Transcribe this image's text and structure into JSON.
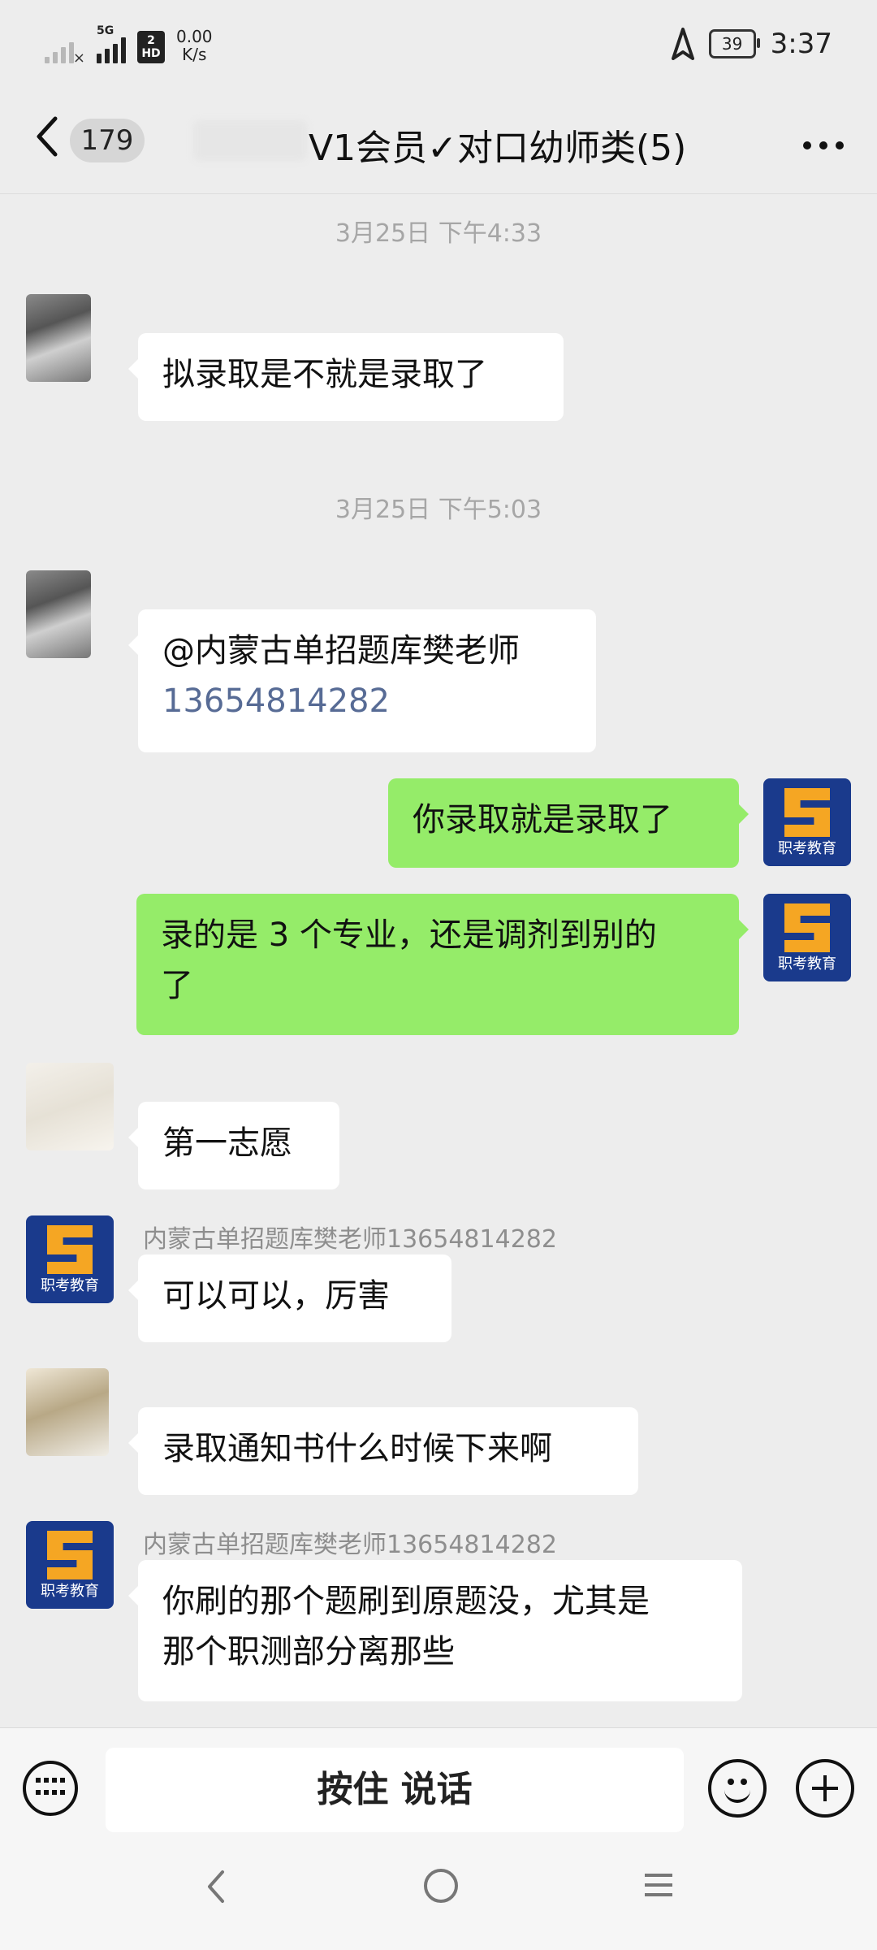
{
  "status_bar": {
    "network_label": "5G",
    "hd_label_top": "2",
    "hd_label_bottom": "HD",
    "speed_value": "0.00",
    "speed_unit": "K/s",
    "battery": "39",
    "time": "3:37"
  },
  "header": {
    "back_icon": "chevron-left-icon",
    "unread_count": "179",
    "title": "V1会员✓对口幼师类(5)",
    "more_icon": "more-icon"
  },
  "messages": [
    {
      "type": "time",
      "text": "3月25日 下午4:33"
    },
    {
      "type": "in",
      "sender": "",
      "text": "拟录取是不就是录取了"
    },
    {
      "type": "time",
      "text": "3月25日 下午5:03"
    },
    {
      "type": "in",
      "sender": "",
      "text": "@内蒙古单招题库樊老师",
      "text2": "13654814282"
    },
    {
      "type": "out",
      "text": "你录取就是录取了"
    },
    {
      "type": "out",
      "text": "录的是 3 个专业，还是调剂到别的",
      "text2": "了"
    },
    {
      "type": "in",
      "sender": "",
      "text": "第一志愿"
    },
    {
      "type": "in",
      "sender": "内蒙古单招题库樊老师13654814282",
      "text": "可以可以，厉害"
    },
    {
      "type": "in",
      "sender": "",
      "text": "录取通知书什么时候下来啊"
    },
    {
      "type": "in",
      "sender": "内蒙古单招题库樊老师13654814282",
      "text": "你刷的那个题刷到原题没，尤其是",
      "text2": "那个职测部分离那些"
    }
  ],
  "logo_label": "职考教育",
  "input_bar": {
    "hold_to_talk": "按住 说话",
    "keyboard_icon": "keyboard-icon",
    "emoji_icon": "emoji-icon",
    "plus_icon": "plus-icon"
  },
  "nav_bar": {
    "back_icon": "nav-back-icon",
    "home_icon": "nav-home-icon",
    "menu_icon": "nav-menu-icon"
  },
  "colors": {
    "background": "#ededed",
    "outgoing_bubble": "#95ec69",
    "incoming_bubble": "#ffffff",
    "mention_link": "#576b95",
    "logo_blue": "#1a3a8c",
    "logo_orange": "#f5a623"
  }
}
